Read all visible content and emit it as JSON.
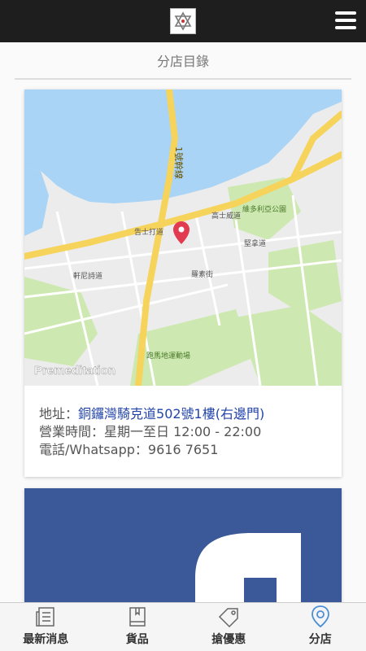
{
  "header": {
    "logo_icon": "hexagram-logo-icon",
    "menu_icon": "hamburger-menu-icon"
  },
  "page": {
    "title": "分店目錄"
  },
  "map": {
    "labels": {
      "road_no1": "1號幹線",
      "gloucester_rd": "告士打道",
      "hennessy": "軒尼詩道",
      "mt_parish": "羅素街",
      "kennedy_rd": "堅拿道",
      "victoria_park": "維多利亞公園",
      "causeway_rd": "高士威道",
      "happy_valley": "跑馬地運動場",
      "watermark": "Premeditation"
    },
    "colors": {
      "water": "#a9d4f5",
      "land": "#ececec",
      "park": "#cde8b0",
      "road_major": "#f6d35a",
      "road_minor": "#ffffff",
      "pin": "#e03b4e"
    }
  },
  "branch": {
    "address_label": "地址：",
    "address_value": "銅鑼灣騎克道502號1樓(右邊門)",
    "hours_label": "營業時間：",
    "hours_value": "星期一至日 12:00 - 22:00",
    "phone_label": "電話/Whatsapp：",
    "phone_value": "9616 7651"
  },
  "promo_card": {
    "icon": "facebook-icon",
    "color": "#3b5998"
  },
  "bottom_nav": {
    "items": [
      {
        "label": "最新消息",
        "icon": "newspaper-icon"
      },
      {
        "label": "貨品",
        "icon": "book-icon"
      },
      {
        "label": "搶優惠",
        "icon": "tag-icon"
      },
      {
        "label": "分店",
        "icon": "map-pin-icon",
        "active": true
      }
    ],
    "active_color": "#4a8fd8"
  }
}
